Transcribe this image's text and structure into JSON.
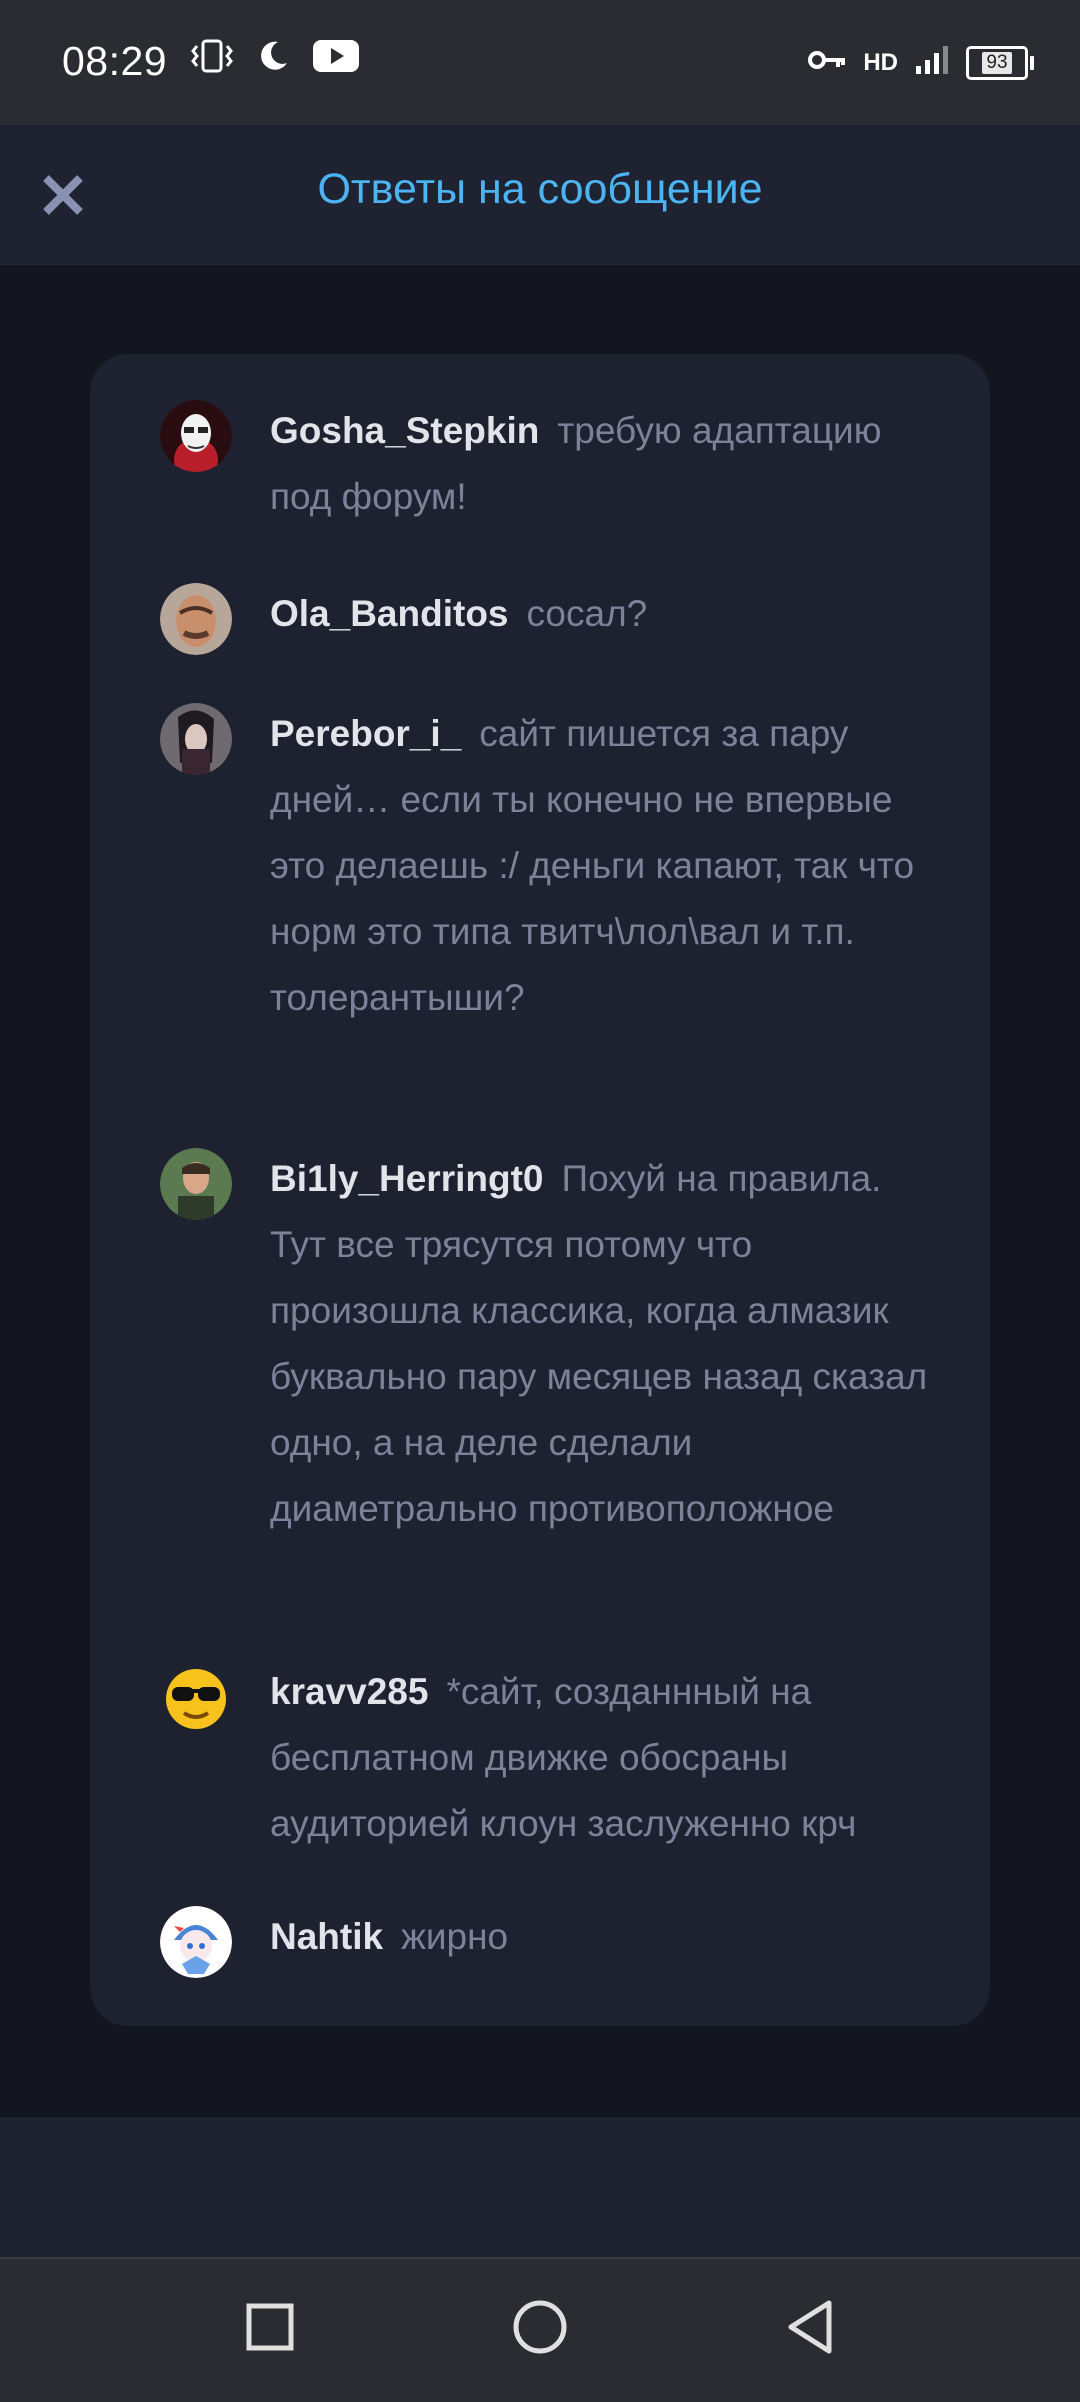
{
  "status_bar": {
    "time": "08:29",
    "network": "HD",
    "battery": "93",
    "icons": [
      "vibrate-icon",
      "moon-icon",
      "youtube-icon",
      "key-icon",
      "signal-icon",
      "battery-icon"
    ]
  },
  "header": {
    "title": "Ответы на сообщение",
    "close_icon": "close-icon",
    "accent_color": "#4cb4f2"
  },
  "replies": [
    {
      "author": "Gosha_Stepkin",
      "text": "требую адаптацию под форум!"
    },
    {
      "author": "Ola_Banditos",
      "text": "сосал?"
    },
    {
      "author": "Perebor_i_",
      "text": "сайт пишется за пару дней… если ты конечно не впервые это делаешь :/ деньги капают, так что норм это типа твитч\\лол\\вал и т.п. толерантыши?"
    },
    {
      "author": "Bi1ly_Herringt0",
      "text": "Похуй на правила. Тут все трясутся потому что произошла классика, когда алмазик буквально пару месяцев назад сказал одно, а на деле сделали диаметрально противоположное"
    },
    {
      "author": "kravv285",
      "text": "*сайт, созданнный на бесплатном движке обосраны аудиторией клоун заслуженно крч"
    },
    {
      "author": "Nahtik",
      "text": "жирно"
    }
  ],
  "nav_bar": {
    "icons": [
      "recent-apps-icon",
      "home-icon",
      "back-icon"
    ]
  }
}
